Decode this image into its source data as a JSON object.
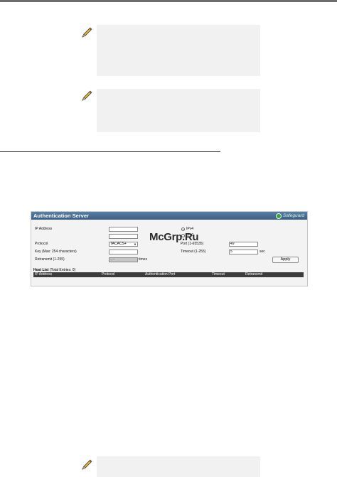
{
  "watermark": "McGrp.Ru",
  "panel": {
    "title": "Authentication Server",
    "badge": "Safeguard",
    "labels": {
      "ip_address": "IP Address",
      "protocol": "Protocol",
      "key": "Key (Max: 254 characters)",
      "retransmit": "Retransmit (1-255)",
      "port": "Port (1-65535)",
      "timeout": "Timeout (1-255)",
      "times": "times",
      "sec": "sec"
    },
    "ipv4_label": "IPv4",
    "ipv6_label": "IPv6",
    "ip_type_selected": "IPv4",
    "protocol_value": "TACACS+",
    "port_value": "49",
    "timeout_value": "5",
    "retransmit_value": "----",
    "apply_label": "Apply",
    "host_list_label": "Host List",
    "host_list_total": "(Total Entries: 0)",
    "columns": [
      "IP Address",
      "Protocol",
      "Authentication Port",
      "Timeout",
      "Retransmit"
    ]
  }
}
